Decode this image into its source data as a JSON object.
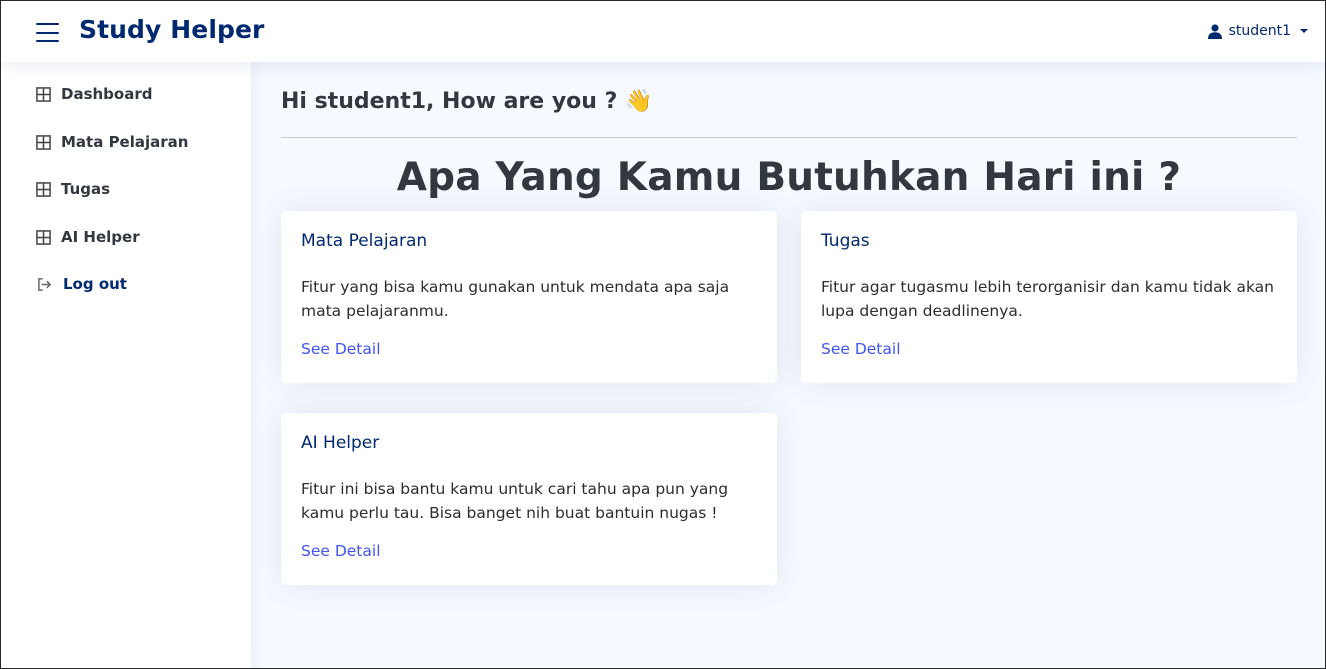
{
  "header": {
    "brand": "Study Helper",
    "user": "student1",
    "menu_icon": "hamburger-icon",
    "user_icon": "person-icon"
  },
  "sidebar": {
    "items": [
      {
        "label": "Dashboard",
        "icon": "grid-icon"
      },
      {
        "label": "Mata Pelajaran",
        "icon": "grid-icon"
      },
      {
        "label": "Tugas",
        "icon": "grid-icon"
      },
      {
        "label": "AI Helper",
        "icon": "grid-icon"
      },
      {
        "label": "Log out",
        "icon": "logout-icon"
      }
    ]
  },
  "main": {
    "greeting": "Hi student1, How are you ?",
    "greeting_emoji": "👋",
    "headline": "Apa Yang Kamu Butuhkan Hari ini ?",
    "cards": [
      {
        "title": "Mata Pelajaran",
        "text": "Fitur yang bisa kamu gunakan untuk mendata apa saja mata pelajaranmu.",
        "link": "See Detail"
      },
      {
        "title": "Tugas",
        "text": "Fitur agar tugasmu lebih terorganisir dan kamu tidak akan lupa dengan deadlinenya.",
        "link": "See Detail"
      },
      {
        "title": "AI Helper",
        "text": "Fitur ini bisa bantu kamu untuk cari tahu apa pun yang kamu perlu tau. Bisa banget nih buat bantuin nugas !",
        "link": "See Detail"
      }
    ]
  },
  "colors": {
    "brand": "#012970",
    "link": "#4154f1",
    "background": "#f6f9ff"
  }
}
